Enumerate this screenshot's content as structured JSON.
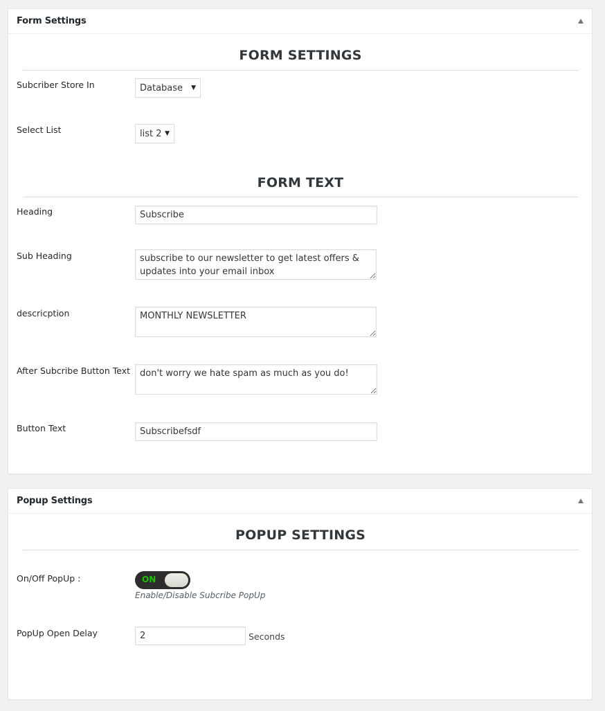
{
  "form_box": {
    "title": "Form Settings",
    "collapse_icon": "triangle-up-icon",
    "sections": {
      "settings_title": "FORM SETTINGS",
      "text_title": "FORM TEXT"
    },
    "store_in": {
      "label": "Subcriber Store In",
      "value": "Database",
      "caret": "▼"
    },
    "select_list": {
      "label": "Select List",
      "value": "list 2",
      "caret": "▼"
    },
    "heading": {
      "label": "Heading",
      "value": "Subscribe"
    },
    "sub_heading": {
      "label": "Sub Heading",
      "value": "subscribe to our newsletter to get latest offers & updates into your email inbox"
    },
    "description": {
      "label": "descricption",
      "value": "MONTHLY NEWSLETTER"
    },
    "after_button_text": {
      "label": "After Subcribe Button Text",
      "value": "don't worry we hate spam as much as you do!"
    },
    "button_text": {
      "label": "Button Text",
      "value": "Subscribefsdf"
    }
  },
  "popup_box": {
    "title": "Popup Settings",
    "collapse_icon": "triangle-up-icon",
    "section_title": "POPUP SETTINGS",
    "toggle": {
      "label": "On/Off PopUp :",
      "state_text": "ON",
      "checked": true,
      "hint": "Enable/Disable Subcribe PopUp"
    },
    "delay": {
      "label": "PopUp Open Delay",
      "value": "2",
      "unit": "Seconds"
    }
  }
}
